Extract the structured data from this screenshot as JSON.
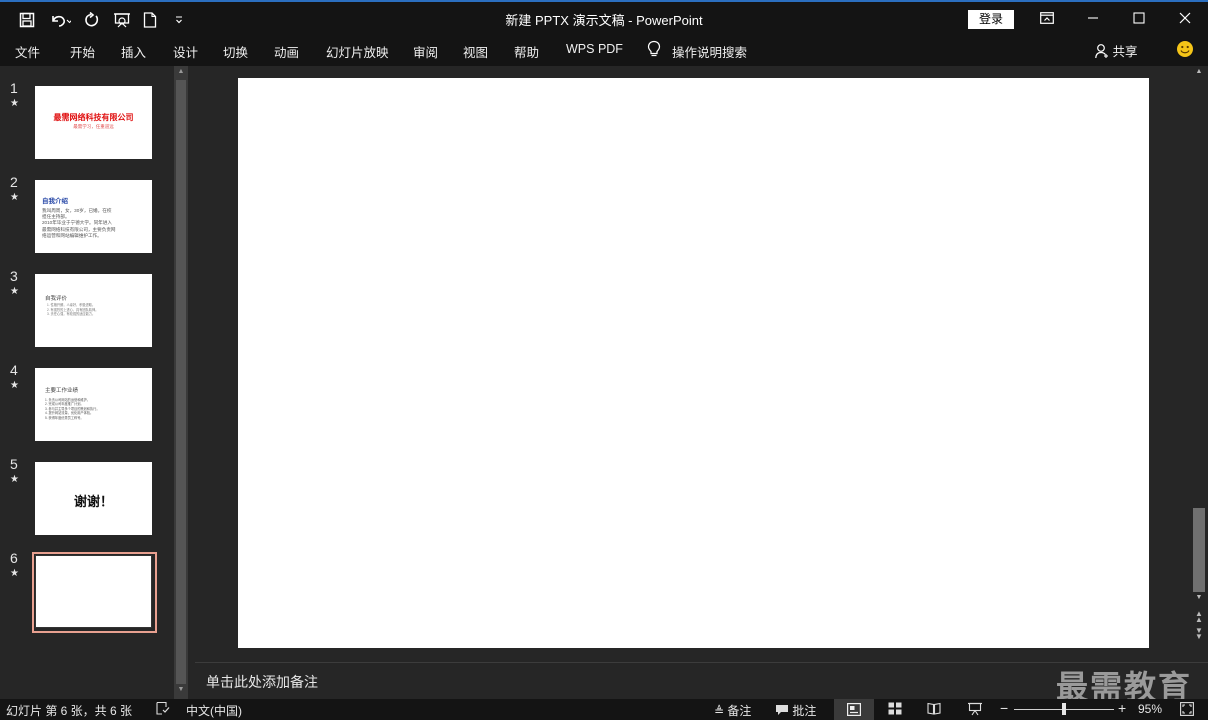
{
  "window": {
    "title": "新建 PPTX 演示文稿  -  PowerPoint",
    "login": "登录",
    "quick_access": [
      "save-icon",
      "undo-icon",
      "redo-icon",
      "present-icon",
      "new-file-icon",
      "customize-icon"
    ]
  },
  "menu": [
    "文件",
    "开始",
    "插入",
    "设计",
    "切换",
    "动画",
    "幻灯片放映",
    "审阅",
    "视图",
    "帮助",
    "WPS PDF"
  ],
  "tell_me": "操作说明搜索",
  "share": "共享",
  "thumbnails": [
    {
      "num": "1",
      "title": "最需网络科技有限公司",
      "subtitle": "最需学习，任重道远",
      "title_color": "#e01010"
    },
    {
      "num": "2",
      "title": "自我介绍",
      "lines": [
        "  我叫周周，女，30岁，已婚。在校",
        "担任主持部。",
        "  2010年毕业于宁德大学。同年进入",
        "最需网络科技有限公司，主要负责网",
        "络运营和网站编辑维护工作。"
      ],
      "title_color": "#2a4aa8"
    },
    {
      "num": "3",
      "title": "自我评价",
      "lines": [
        "1. 性格开朗，人缘好，积极进取。",
        "2. 有强烈的上进心，具有团队精神。",
        "3. 责任心强，有较强的适应能力。"
      ]
    },
    {
      "num": "4",
      "title": "主要工作业绩",
      "lines": [
        "1. 负责公司网站的运营和维护。",
        "2. 完成公司年度推广计划。",
        "3. 参与并主导多个项目的策划和执行。",
        "4. 提升网站流量，优化用户体验。",
        "5. 获得年度优秀员工称号。"
      ]
    },
    {
      "num": "5",
      "title": "谢谢！"
    },
    {
      "num": "6",
      "title": ""
    }
  ],
  "notes_placeholder": "单击此处添加备注",
  "watermark": "最需教育",
  "status": {
    "slide_info": "幻灯片 第 6 张，共 6 张",
    "language": "中文(中国)",
    "notes_btn": "备注",
    "comments_btn": "批注",
    "zoom": "95%",
    "zoom_level": 0.5
  }
}
